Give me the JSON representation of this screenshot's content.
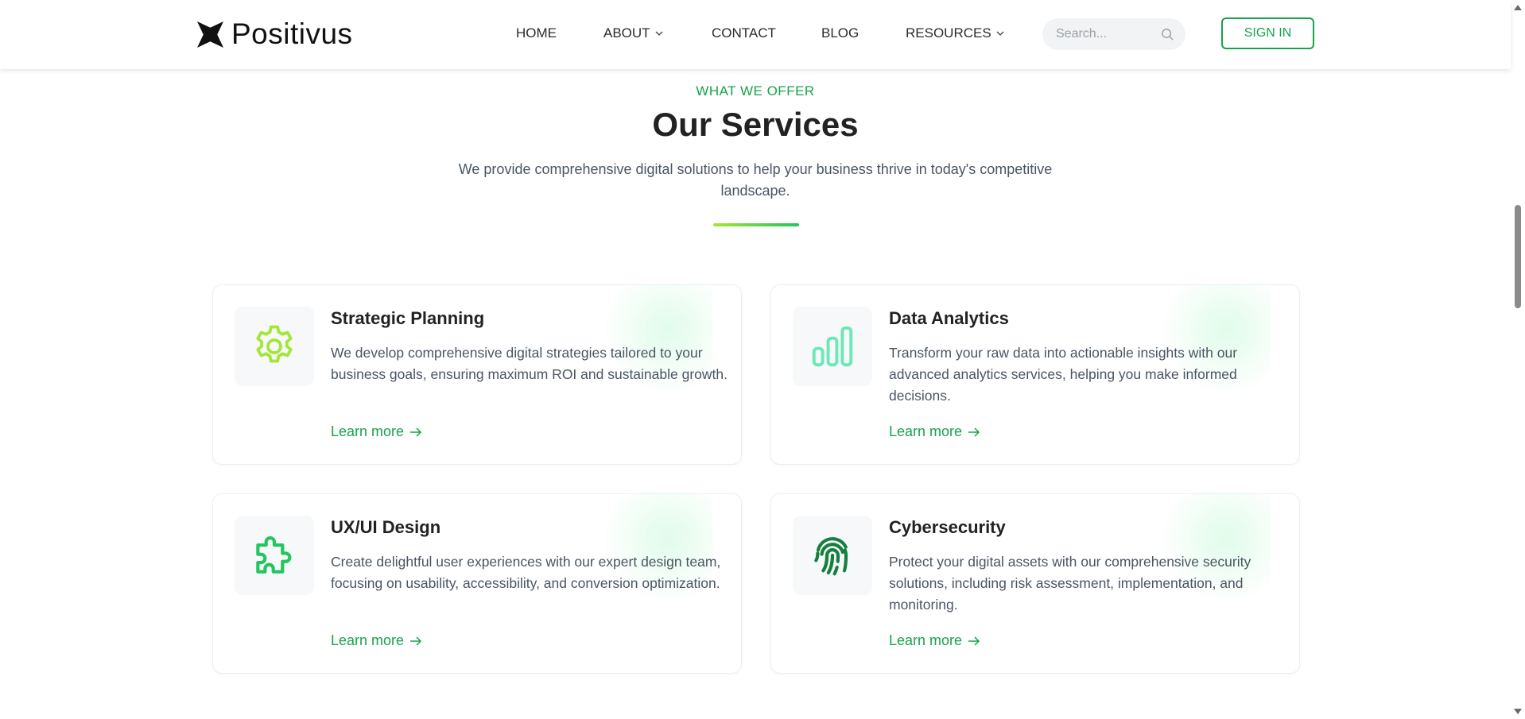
{
  "brand": {
    "name": "Positivus"
  },
  "nav": {
    "items": [
      {
        "label": "HOME",
        "has_dropdown": false
      },
      {
        "label": "ABOUT",
        "has_dropdown": true
      },
      {
        "label": "CONTACT",
        "has_dropdown": false
      },
      {
        "label": "BLOG",
        "has_dropdown": false
      },
      {
        "label": "RESOURCES",
        "has_dropdown": true
      }
    ],
    "search_placeholder": "Search...",
    "signin_label": "SIGN IN"
  },
  "section": {
    "eyebrow": "WHAT WE OFFER",
    "title": "Our Services",
    "subtitle": "We provide comprehensive digital solutions to help your business thrive in today's competitive landscape."
  },
  "services": [
    {
      "title": "Strategic Planning",
      "description": "We develop comprehensive digital strategies tailored to your business goals, ensuring maximum ROI and sustainable growth.",
      "link": "Learn more",
      "icon": "gear-icon",
      "icon_color": "#a3e635"
    },
    {
      "title": "Data Analytics",
      "description": "Transform your raw data into actionable insights with our advanced analytics services, helping you make informed decisions.",
      "link": "Learn more",
      "icon": "bar-chart-icon",
      "icon_color": "#6ee7b7"
    },
    {
      "title": "UX/UI Design",
      "description": "Create delightful user experiences with our expert design team, focusing on usability, accessibility, and conversion optimization.",
      "link": "Learn more",
      "icon": "puzzle-icon",
      "icon_color": "#22c55e"
    },
    {
      "title": "Cybersecurity",
      "description": "Protect your digital assets with our comprehensive security solutions, including risk assessment, implementation, and monitoring.",
      "link": "Learn more",
      "icon": "fingerprint-icon",
      "icon_color": "#15803d"
    }
  ],
  "colors": {
    "accent": "#16a34a",
    "text": "#222222",
    "muted": "#4b5563"
  }
}
